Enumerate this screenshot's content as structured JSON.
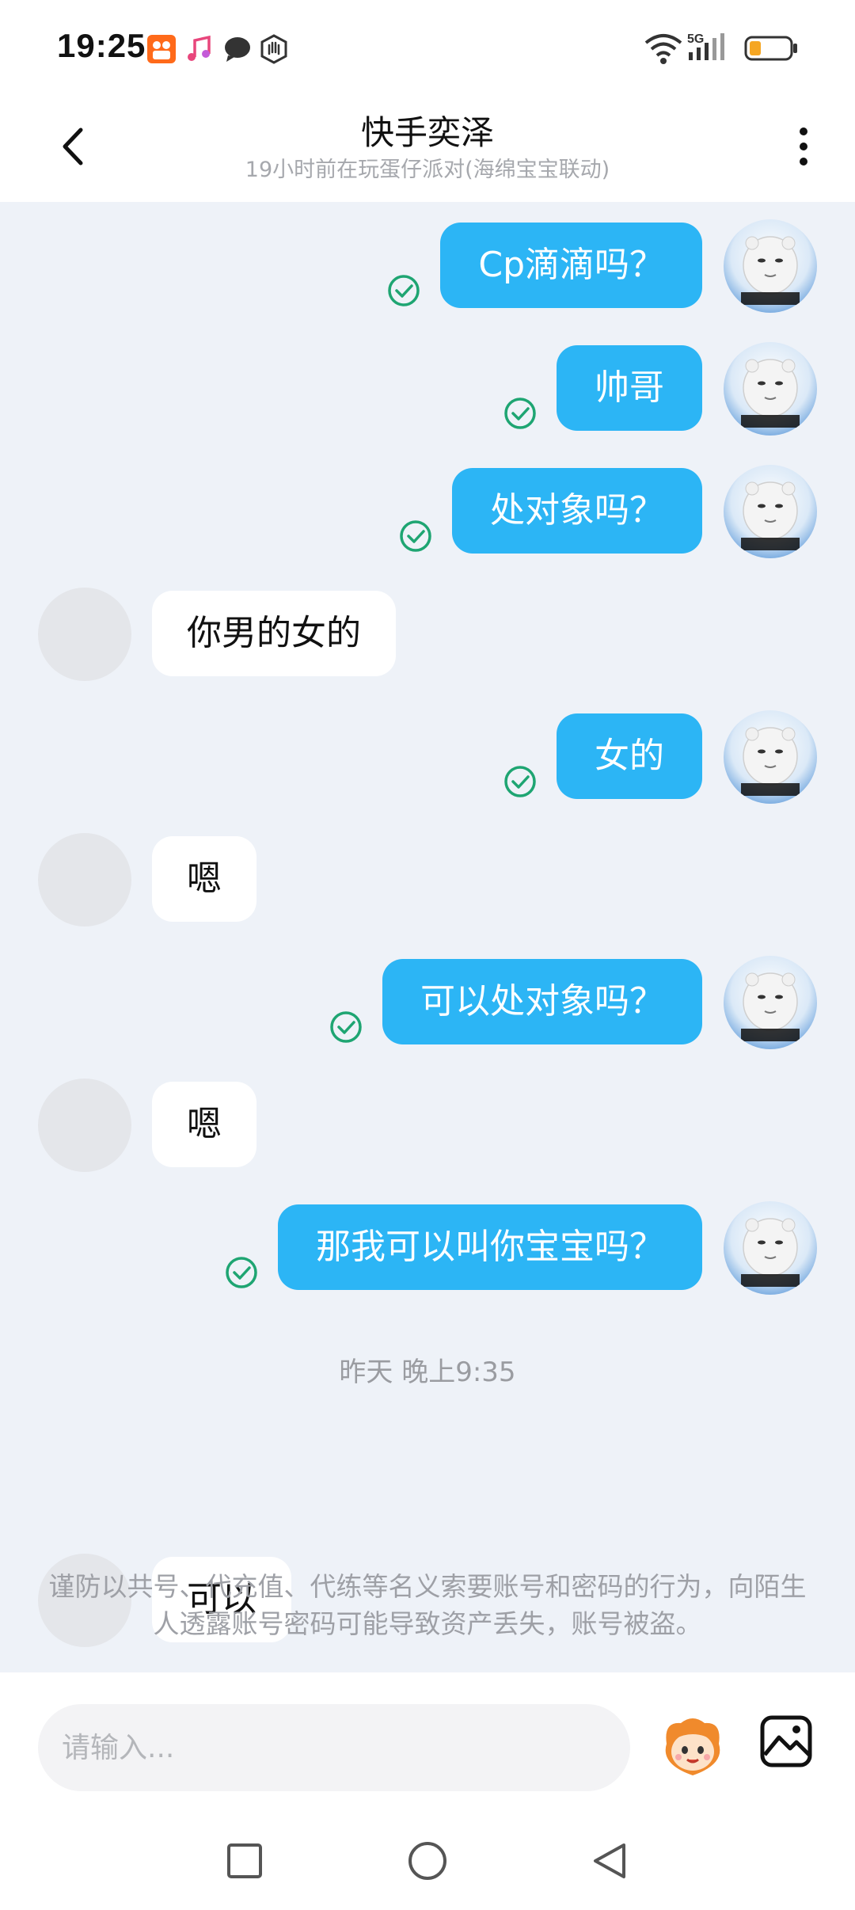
{
  "status_bar": {
    "time": "19:25",
    "network": "5G",
    "icons": [
      "kuaishou-app-icon",
      "music-icon",
      "chat-icon",
      "hand-icon",
      "wifi-icon",
      "signal-icon",
      "battery-icon"
    ]
  },
  "header": {
    "title": "快手奕泽",
    "subtitle": "19小时前在玩蛋仔派对(海绵宝宝联动)"
  },
  "messages": [
    {
      "from": "me",
      "text": "Cp滴滴吗？",
      "read": true
    },
    {
      "from": "me",
      "text": "帅哥",
      "read": true
    },
    {
      "from": "me",
      "text": "处对象吗？",
      "read": true
    },
    {
      "from": "other",
      "text": "你男的女的"
    },
    {
      "from": "me",
      "text": "女的",
      "read": true
    },
    {
      "from": "other",
      "text": "嗯"
    },
    {
      "from": "me",
      "text": "可以处对象吗？",
      "read": true
    },
    {
      "from": "other",
      "text": "嗯"
    },
    {
      "from": "me",
      "text": "那我可以叫你宝宝吗？",
      "read": true
    },
    {
      "from": "other",
      "text": "可以"
    }
  ],
  "timestamp": "昨天 晚上9:35",
  "notice": "谨防以共号、代充值、代练等名义索要账号和密码的行为，向陌生人透露账号密码可能导致资产丢失，账号被盗。",
  "input": {
    "placeholder": "请输入..."
  },
  "colors": {
    "my_bubble": "#2cb5f5",
    "read_check": "#1ea572",
    "background": "#eef2f8"
  }
}
